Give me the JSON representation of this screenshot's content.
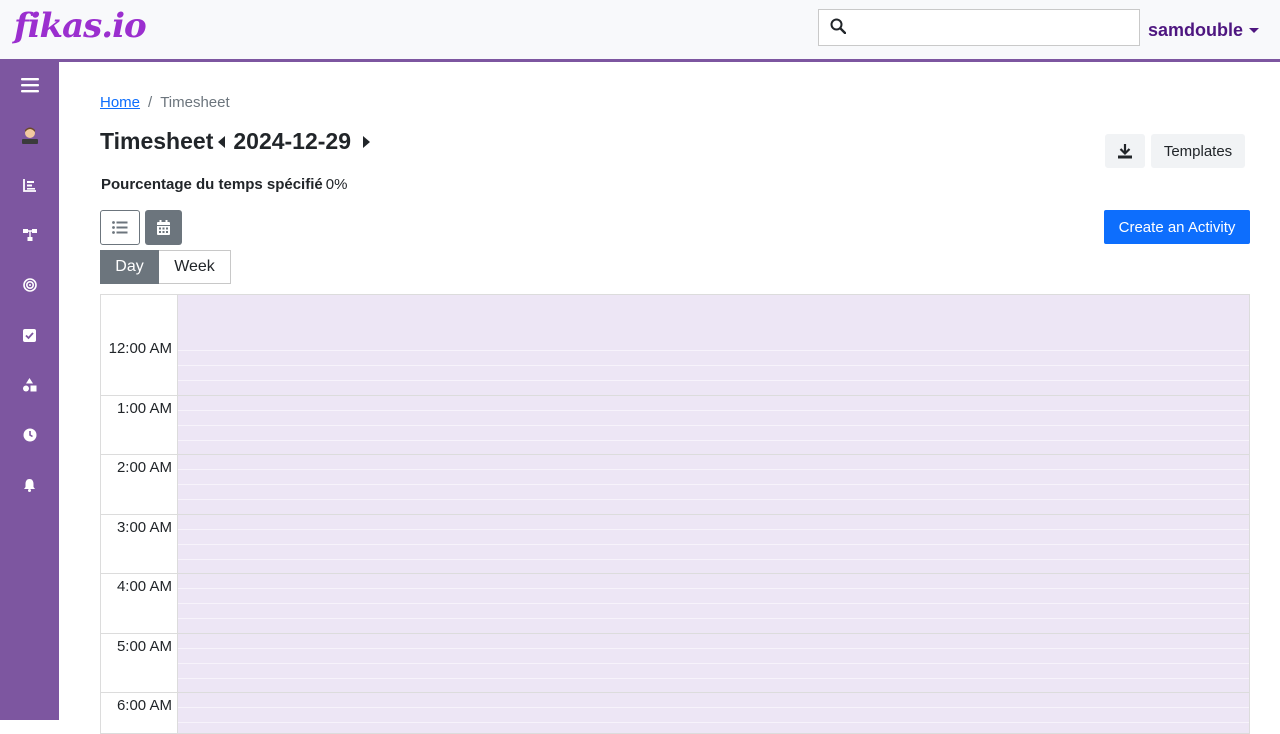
{
  "app": {
    "logo": "fikas.io"
  },
  "header": {
    "search_placeholder": "",
    "search_value": "",
    "user_name": "samdouble"
  },
  "sidebar": {
    "items": [
      {
        "icon": "hamburger-menu-icon"
      },
      {
        "icon": "user-avatar-icon"
      },
      {
        "icon": "bar-chart-icon"
      },
      {
        "icon": "sitemap-icon"
      },
      {
        "icon": "target-icon"
      },
      {
        "icon": "check-square-icon"
      },
      {
        "icon": "shapes-icon"
      },
      {
        "icon": "clock-icon"
      },
      {
        "icon": "bell-icon"
      }
    ]
  },
  "breadcrumb": {
    "home": "Home",
    "separator": "/",
    "current": "Timesheet"
  },
  "page": {
    "title": "Timesheet",
    "date": "2024-12-29",
    "templates_label": "Templates",
    "percent_label": "Pourcentage du temps spécifié",
    "percent_value": "0%",
    "create_label": "Create an Activity"
  },
  "view_toggle": {
    "day_label": "Day",
    "week_label": "Week",
    "active": "Day"
  },
  "calendar": {
    "hours": [
      "12:00 AM",
      "1:00 AM",
      "2:00 AM",
      "3:00 AM",
      "4:00 AM",
      "5:00 AM",
      "6:00 AM"
    ]
  },
  "colors": {
    "accent": "#7d56a0",
    "logo": "#9b2fcf",
    "user": "#4e1680",
    "primary_button": "#0d6efd",
    "calendar_bg": "#ede6f5"
  }
}
